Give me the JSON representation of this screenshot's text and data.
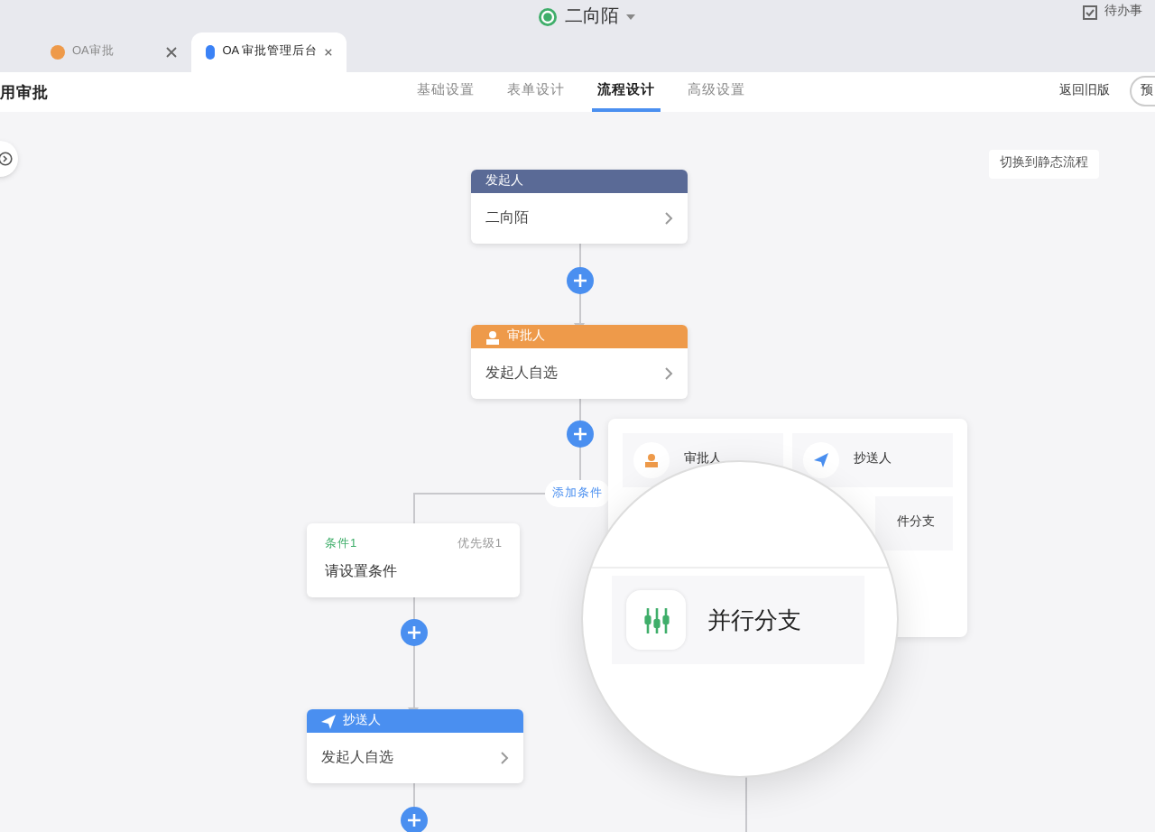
{
  "top_bar": {
    "title": "二向陌",
    "todo": "待办事"
  },
  "browser_tabs": [
    {
      "label": "OA审批",
      "selected": false
    },
    {
      "label": "OA 审批管理后台",
      "selected": true
    }
  ],
  "header": {
    "title": "用审批",
    "nav": [
      {
        "label": "基础设置",
        "selected": false
      },
      {
        "label": "表单设计",
        "selected": false
      },
      {
        "label": "流程设计",
        "selected": true
      },
      {
        "label": "高级设置",
        "selected": false
      }
    ],
    "back": "返回旧版",
    "preview": "预"
  },
  "switch_button": "切换到静态流程",
  "nodes": [
    {
      "kind": "starter",
      "title": "发起人",
      "value": "二向陌"
    },
    {
      "kind": "approver",
      "title": "审批人",
      "value": "发起人自选"
    }
  ],
  "add_condition": "添加条件",
  "condition": {
    "name": "条件1",
    "priority": "优先级1",
    "text": "请设置条件"
  },
  "cc_node": {
    "kind": "cc",
    "title": "抄送人",
    "value": "发起人自选"
  },
  "menu": [
    {
      "kind": "approver",
      "label": "审批人"
    },
    {
      "kind": "cc",
      "label": "抄送人"
    },
    {
      "kind": "branch",
      "label": "件分支"
    }
  ],
  "magnified_item": {
    "label": "并行分支"
  }
}
